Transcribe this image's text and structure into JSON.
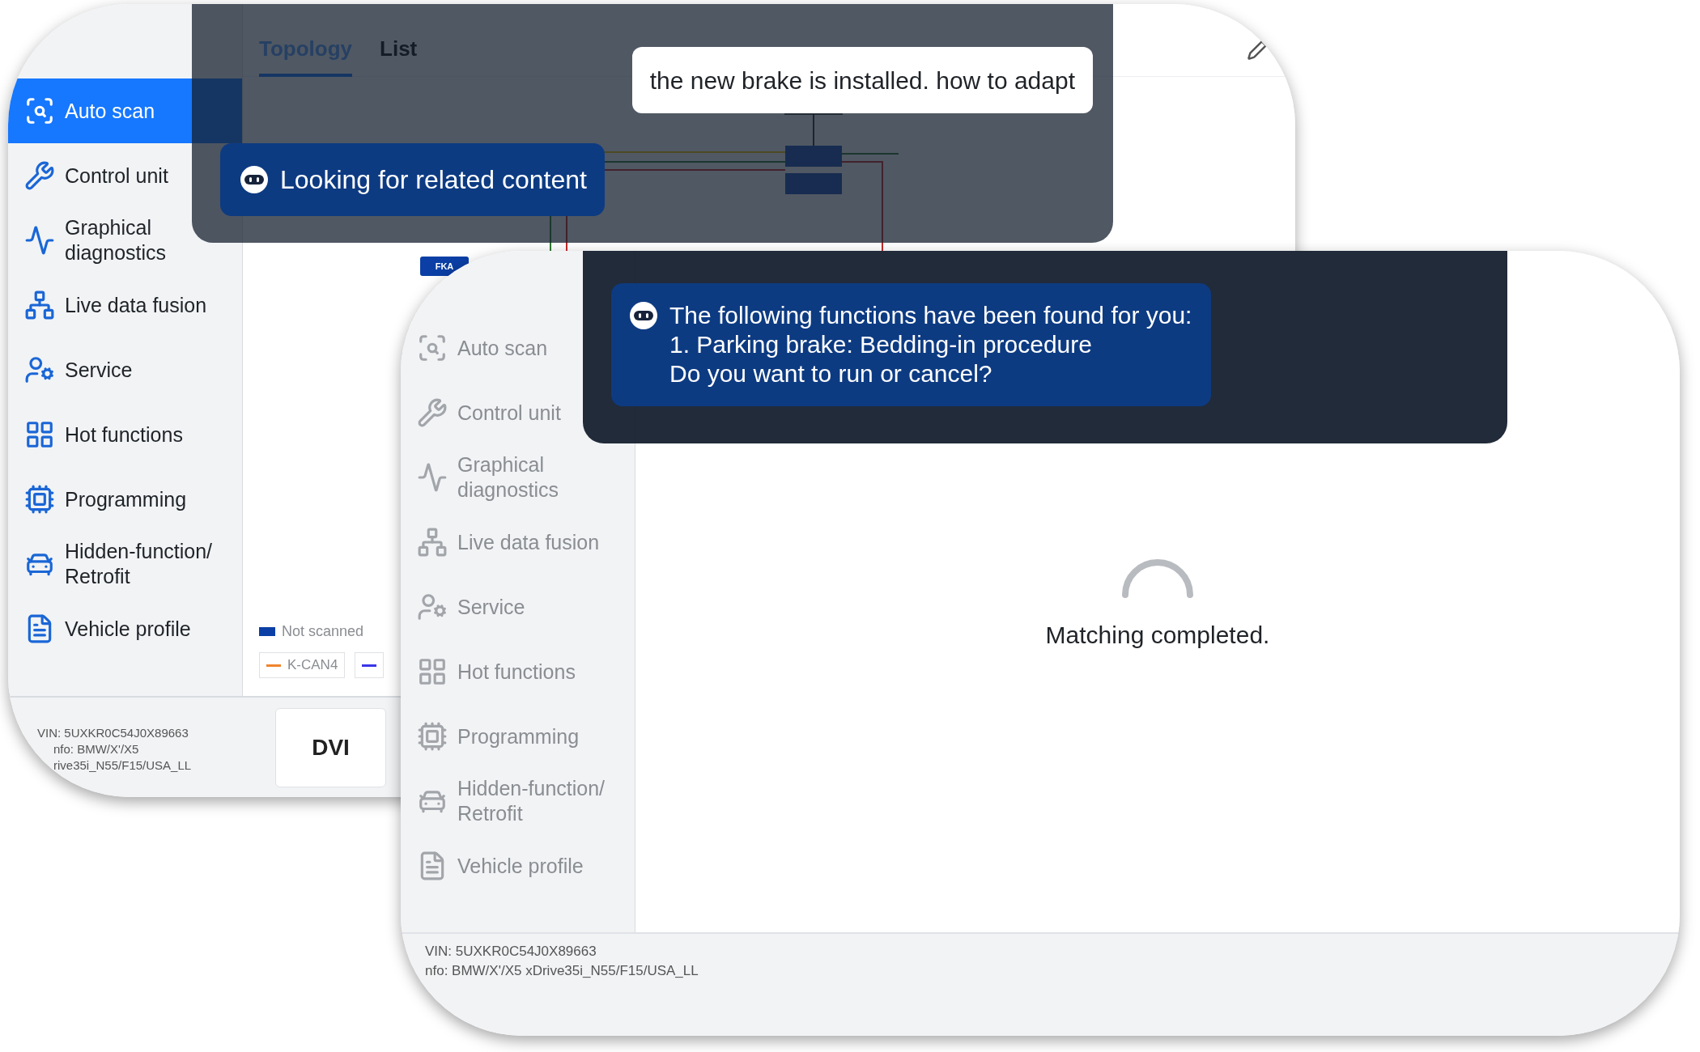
{
  "back_window": {
    "tabs": [
      {
        "label": "Topology",
        "selected": true
      },
      {
        "label": "List",
        "selected": false
      }
    ],
    "sidebar": {
      "items": [
        {
          "label": "Auto scan",
          "selected": true
        },
        {
          "label": "Control unit",
          "selected": false
        },
        {
          "label": "Graphical diagnostics",
          "selected": false
        },
        {
          "label": "Live data fusion",
          "selected": false
        },
        {
          "label": "Service",
          "selected": false
        },
        {
          "label": "Hot functions",
          "selected": false
        },
        {
          "label": "Programming",
          "selected": false
        },
        {
          "label": "Hidden-function/ Retrofit",
          "selected": false
        },
        {
          "label": "Vehicle profile",
          "selected": false
        }
      ]
    },
    "diagram": {
      "node_label": "FKA"
    },
    "legend": [
      {
        "label": "Not scanned",
        "color": "#0b3fa6"
      }
    ],
    "bus_lines": [
      {
        "label": "K-CAN4",
        "color": "#f0852d"
      },
      {
        "color": "#3a36e8"
      }
    ],
    "footer": {
      "vin": "VIN: 5UXKR0C54J0X89663",
      "info_lines": [
        "nfo: BMW/X'/X5",
        "rive35i_N55/F15/USA_LL"
      ]
    },
    "dvi_button": "DVI",
    "assistant": {
      "user_message": "the new brake is installed. how to adapt",
      "bot_message": "Looking for related content"
    }
  },
  "front_window": {
    "sidebar": {
      "items": [
        {
          "label": "Auto scan",
          "selected": false
        },
        {
          "label": "Control unit",
          "selected": false
        },
        {
          "label": "Graphical diagnostics",
          "selected": false
        },
        {
          "label": "Live data fusion",
          "selected": false
        },
        {
          "label": "Service",
          "selected": false
        },
        {
          "label": "Hot functions",
          "selected": false
        },
        {
          "label": "Programming",
          "selected": false
        },
        {
          "label": "Hidden-function/ Retrofit",
          "selected": false
        },
        {
          "label": "Vehicle profile",
          "selected": false
        }
      ]
    },
    "assistant": {
      "bot_message_lines": [
        "The following functions have been found for you:",
        "1. Parking brake: Bedding-in procedure",
        "Do you want to run or cancel?"
      ]
    },
    "status": "Matching completed.",
    "footer": {
      "vin": "VIN: 5UXKR0C54J0X89663",
      "info": "nfo: BMW/X'/X5 xDrive35i_N55/F15/USA_LL"
    }
  }
}
